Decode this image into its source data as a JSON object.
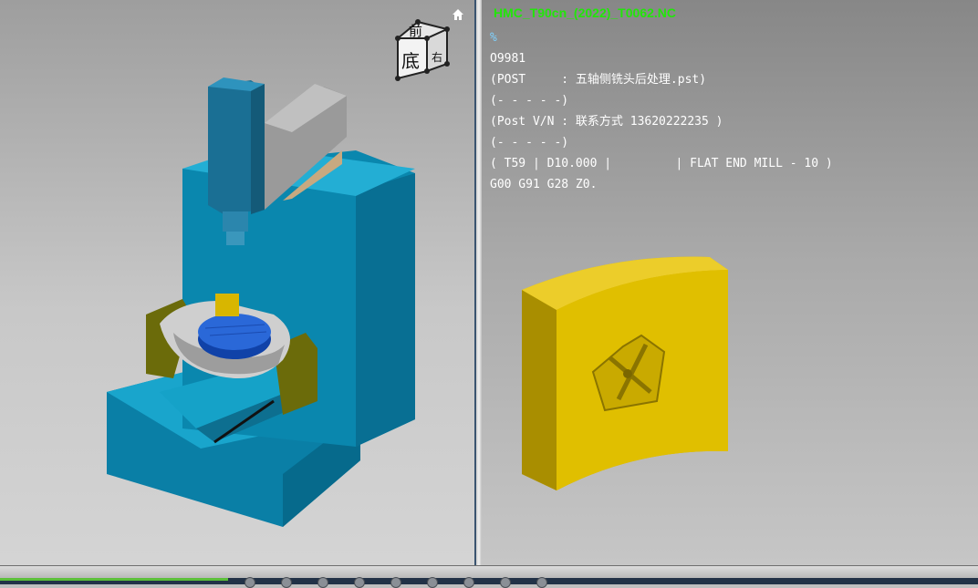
{
  "nc_program": {
    "filename": "HMC_T90cn_(2022)_T0062.NC",
    "lines": [
      "%",
      "O9981",
      "(POST     : 五轴侧铣头后处理.pst)",
      "(- - - - -)",
      "(Post V/N : 联系方式 13620222235 )",
      "(- - - - -)",
      "( T59 | D10.000 |         | FLAT END MILL - 10 )",
      "G00 G91 G28 Z0."
    ]
  },
  "view_cube": {
    "front_label": "前",
    "bottom_label": "底",
    "side_label": "右"
  },
  "icons": {
    "home": "home-icon",
    "view_cube": "view-cube-icon"
  },
  "colors": {
    "machine_body": "#0b8ab0",
    "spindle": "#1a7fa8",
    "table": "#1e5fd1",
    "workpiece": "#e3c000",
    "trunnion_support": "#6e6e0a",
    "nc_filename": "#22e60a",
    "status_bar": "#223247"
  }
}
